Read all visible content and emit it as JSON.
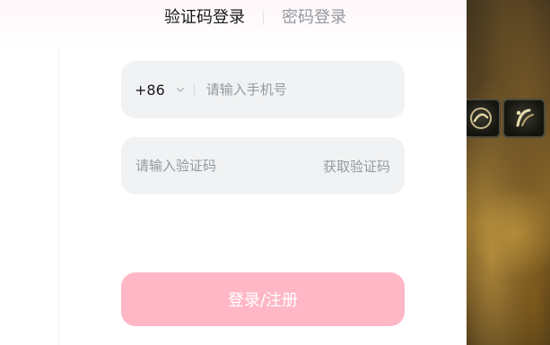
{
  "tabs": {
    "sms_login": "验证码登录",
    "password_login": "密码登录",
    "active": "sms_login"
  },
  "phone": {
    "country_code": "+86",
    "placeholder": "请输入手机号",
    "value": ""
  },
  "code": {
    "placeholder": "请输入验证码",
    "value": "",
    "get_code_label": "获取验证码"
  },
  "submit": {
    "label": "登录/注册"
  },
  "colors": {
    "submit_bg": "#ffb7c6",
    "field_bg": "#f1f2f3",
    "text_primary": "#18191c",
    "text_secondary": "#9499a0"
  },
  "icons": {
    "country_dropdown": "chevron-down-icon",
    "game_items": [
      "game-item-icon",
      "game-item-icon"
    ]
  }
}
